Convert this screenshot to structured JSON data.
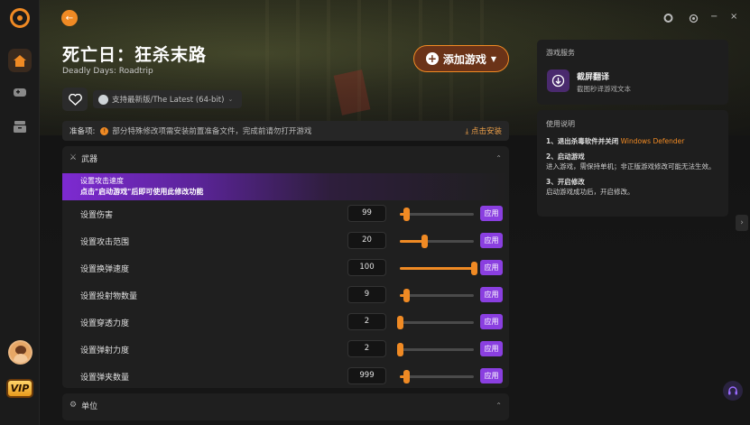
{
  "game": {
    "title": "死亡日：狂杀末路",
    "subtitle": "Deadly Days: Roadtrip",
    "add_button": "添加游戏",
    "version": "支持最新版/The Latest (64-bit)"
  },
  "prep": {
    "label": "准备项:",
    "text": "部分特殊修改项需安装前置准备文件，完成前请勿打开游戏",
    "install": "点击安装"
  },
  "panel": {
    "title": "武器",
    "banner_line1": "设置攻击速度",
    "banner_line2": "点击\"启动游戏\"后即可使用此修改功能",
    "apply_label": "应用",
    "rows": [
      {
        "name": "设置伤害",
        "value": "99",
        "level": 0.08
      },
      {
        "name": "设置攻击范围",
        "value": "20",
        "level": 0.33
      },
      {
        "name": "设置换弹速度",
        "value": "100",
        "level": 1.0
      },
      {
        "name": "设置投射物数量",
        "value": "9",
        "level": 0.08
      },
      {
        "name": "设置穿透力度",
        "value": "2",
        "level": 0.0
      },
      {
        "name": "设置弹射力度",
        "value": "2",
        "level": 0.0
      },
      {
        "name": "设置弹夹数量",
        "value": "999",
        "level": 0.08
      }
    ]
  },
  "panel2": {
    "title": "单位"
  },
  "services": {
    "title": "游戏服务",
    "item_title": "截屏翻译",
    "item_desc": "截图秒译游戏文本"
  },
  "instructions": {
    "title": "使用说明",
    "step1": "1、退出杀毒软件并关闭",
    "step1_hl": "Windows Defender",
    "step2": "2、启动游戏",
    "step2_desc": "进入游戏，需保持单机；非正版游戏修改可能无法生效。",
    "step3": "3、开启修改",
    "step3_desc": "启动游戏成功后，开启修改。"
  },
  "vip": "VIP",
  "colors": {
    "accent": "#f08a24",
    "purple": "#8a3fe0"
  }
}
